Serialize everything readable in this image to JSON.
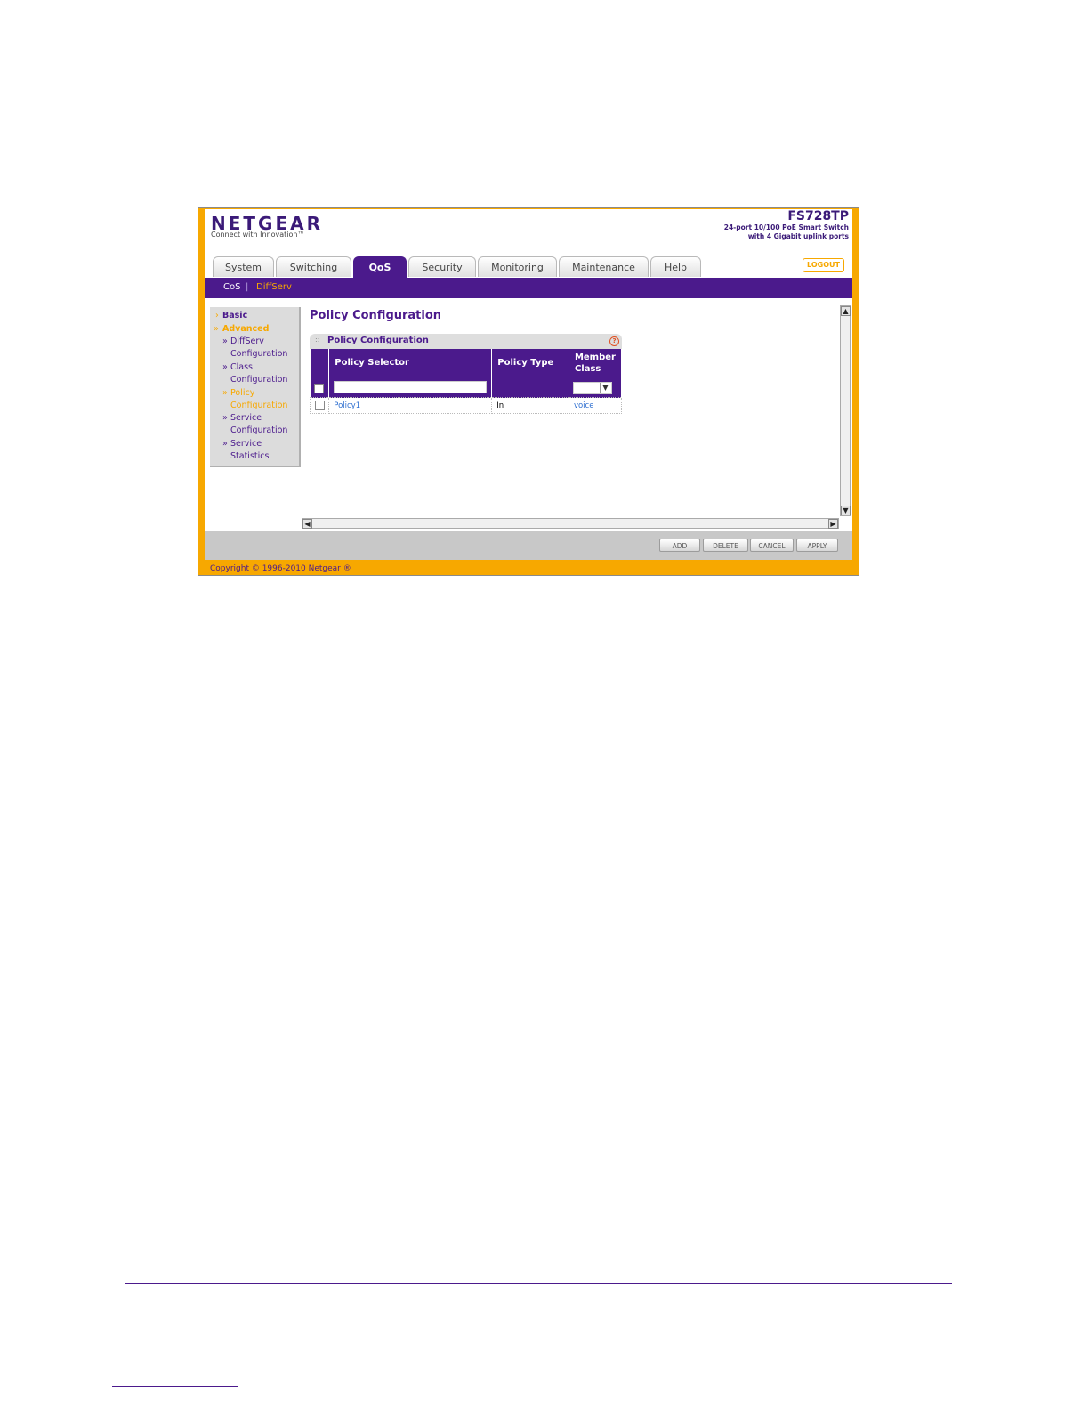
{
  "header": {
    "brand": "NETGEAR",
    "tagline": "Connect with Innovation™",
    "model": "FS728TP",
    "model_desc": "24-port 10/100 PoE Smart Switch\nwith 4 Gigabit uplink ports",
    "logout_label": "LOGOUT"
  },
  "tabs": [
    {
      "label": "System"
    },
    {
      "label": "Switching"
    },
    {
      "label": "QoS"
    },
    {
      "label": "Security"
    },
    {
      "label": "Monitoring"
    },
    {
      "label": "Maintenance"
    },
    {
      "label": "Help"
    }
  ],
  "subnav": {
    "items": [
      "CoS",
      "DiffServ"
    ],
    "separator": "|"
  },
  "sidebar": {
    "basic": "Basic",
    "advanced": "Advanced",
    "items": [
      "DiffServ",
      "Configuration",
      "Class",
      "Configuration",
      "Policy",
      "Configuration",
      "Service",
      "Configuration",
      "Service",
      "Statistics"
    ]
  },
  "page": {
    "title": "Policy Configuration",
    "panel_title": "Policy Configuration",
    "help_icon": "?",
    "columns": {
      "selector": "Policy Selector",
      "type": "Policy Type",
      "member1": "Member",
      "member2": "Class"
    },
    "rows": [
      {
        "selector": "Policy1",
        "type": "In",
        "member": "voice"
      }
    ]
  },
  "buttons": {
    "add": "ADD",
    "delete": "DELETE",
    "cancel": "CANCEL",
    "apply": "APPLY"
  },
  "copyright": "Copyright © 1996-2010 Netgear ®",
  "colors": {
    "brand_purple": "#4b1a8c",
    "brand_orange": "#f7a800"
  }
}
